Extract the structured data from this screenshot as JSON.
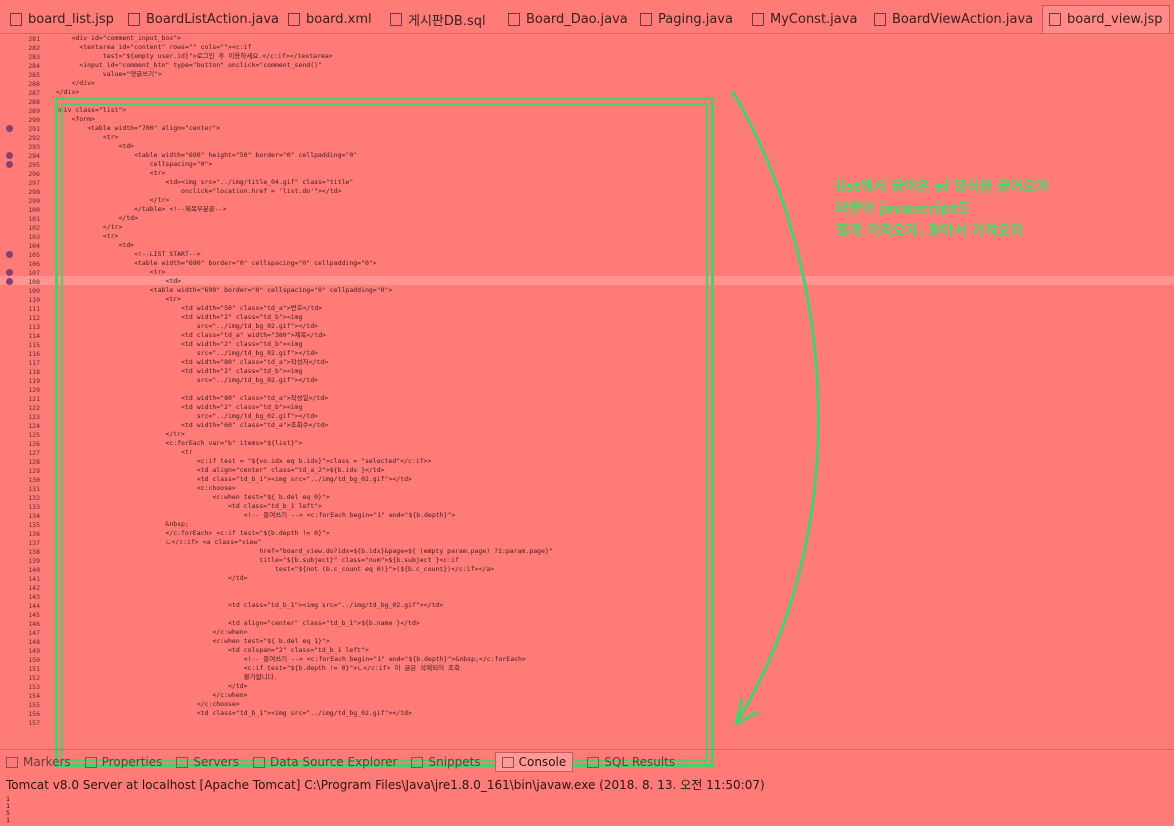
{
  "tabs": [
    {
      "label": "board_list.jsp",
      "icon": "jsp-file-icon"
    },
    {
      "label": "BoardListAction.java",
      "icon": "java-file-icon"
    },
    {
      "label": "board.xml",
      "icon": "xml-file-icon"
    },
    {
      "label": "게시판DB.sql",
      "icon": "sql-file-icon"
    },
    {
      "label": "Board_Dao.java",
      "icon": "java-file-icon"
    },
    {
      "label": "Paging.java",
      "icon": "java-file-icon"
    },
    {
      "label": "MyConst.java",
      "icon": "java-file-icon"
    },
    {
      "label": "BoardViewAction.java",
      "icon": "java-file-icon"
    },
    {
      "label": "board_view.jsp",
      "icon": "jsp-file-icon",
      "active": true
    }
  ],
  "line_numbers": [
    "281",
    "282",
    "283",
    "284",
    "285",
    "286",
    "287",
    "288",
    "289",
    "290",
    "291",
    "292",
    "293",
    "294",
    "295",
    "296",
    "297",
    "298",
    "299",
    "100",
    "101",
    "102",
    "103",
    "104",
    "105",
    "106",
    "107",
    "108",
    "109",
    "110",
    "111",
    "112",
    "113",
    "114",
    "115",
    "116",
    "117",
    "118",
    "119",
    "120",
    "121",
    "122",
    "123",
    "124",
    "125",
    "126",
    "127",
    "128",
    "129",
    "130",
    "131",
    "132",
    "133",
    "134",
    "135",
    "136",
    "137",
    "138",
    "139",
    "140",
    "141",
    "142",
    "143",
    "144",
    "145",
    "146",
    "147",
    "148",
    "149",
    "150",
    "151",
    "152",
    "153",
    "154",
    "155",
    "156",
    "157"
  ],
  "code_lines": [
    "      <div id=\"comment_input_box\">",
    "        <textarea id=\"content\" rows=\"\" cols=\"\"><c:if",
    "              test=\"${empty user.id}\">로그인 후 이용하세요.</c:if></textarea>",
    "        <input id=\"comment_btn\" type=\"button\" onclick=\"comment_send()\"",
    "              value=\"댓글쓰기\">",
    "      </div>",
    "  </div>",
    "",
    "  <div class=\"list\">",
    "      <form>",
    "          <table width=\"700\" align=\"center\">",
    "              <tr>",
    "                  <td>",
    "                      <table width=\"690\" height=\"50\" border=\"0\" cellpadding=\"0\"",
    "                          cellspacing=\"0\">",
    "                          <tr>",
    "                              <td><img src=\"../img/title_04.gif\" class=\"title\"",
    "                                  onclick=\"location.href = 'list.do'\"></td>",
    "                          </tr>",
    "                      </table> <!--제목부분끝-->",
    "                  </td>",
    "              </tr>",
    "              <tr>",
    "                  <td>",
    "                      <!--LIST START-->",
    "                      <table width=\"690\" border=\"0\" cellspacing=\"0\" cellpadding=\"0\">",
    "                          <tr>",
    "                              <td>",
    "                          <table width=\"690\" border=\"0\" cellspacing=\"0\" cellpadding=\"0\">",
    "                              <tr>",
    "                                  <td width=\"50\" class=\"td_a\">번호</td>",
    "                                  <td width=\"2\" class=\"td_b\"><img",
    "                                      src=\"../img/td_bg_02.gif\"></td>",
    "                                  <td class=\"td_a\" width=\"380\">제목</td>",
    "                                  <td width=\"2\" class=\"td_b\"><img",
    "                                      src=\"../img/td_bg_02.gif\"></td>",
    "                                  <td width=\"80\" class=\"td_a\">작성자</td>",
    "                                  <td width=\"2\" class=\"td_b\"><img",
    "                                      src=\"../img/td_bg_02.gif\"></td>",
    "",
    "                                  <td width=\"80\" class=\"td_a\">작성일</td>",
    "                                  <td width=\"2\" class=\"td_b\"><img",
    "                                      src=\"../img/td_bg_02.gif\"></td>",
    "                                  <td width=\"60\" class=\"td_a\">조회수</td>",
    "                              </tr>",
    "                              <c:forEach var=\"b\" items=\"${list}\">",
    "                                  <tr",
    "                                      <c:if test = \"${vo.idx eq b.idx}\">class = \"selected\"</c:if>>",
    "                                      <td align=\"center\" class=\"td_a_2\">${b.idx }</td>",
    "                                      <td class=\"td_b_1\"><img src=\"../img/td_bg_02.gif\"></td>",
    "                                      <c:choose>",
    "                                          <c:when test=\"${ b.del eq 0}\">",
    "                                              <td class=\"td_b_1 left\">",
    "                                                  <!-- 들여쓰기 --> <c:forEach begin=\"1\" end=\"${b.depth}\">",
    "                              &nbsp;",
    "                              </c:forEach> <c:if test=\"${b.depth != 0}\">",
    "                              ㄴ</c:if> <a class=\"view\"",
    "                                                      href=\"board_view.do?idx=${b.idx}&page=${ (empty param.page) ?1:param.page}\"",
    "                                                      title=\"${b.subject}\" class=\"num\">${b.subject }<c:if",
    "                                                          test=\"${not (b.c_count eq 0)}\">(${b.c_count})</c:if></a>",
    "                                              </td>",
    "",
    "",
    "                                              <td class=\"td_b_1\"><img src=\"../img/td_bg_02.gif\"></td>",
    "",
    "                                              <td align=\"center\" class=\"td_b_1\">${b.name }</td>",
    "                                          </c:when>",
    "                                          <c:when test=\"${ b.del eq 1}\">",
    "                                              <td colspan=\"2\" class=\"td_b_1 left\">",
    "                                                  <!-- 들여쓰기 --> <c:forEach begin=\"1\" end=\"${b.depth}\">&nbsp;</c:forEach>",
    "                                                  <c:if test=\"${b.depth != 0}\">ㄴ</c:if> 이 글은 삭제되어 조회",
    "                                                  불가합니다.",
    "                                              </td>",
    "                                          </c:when>",
    "                                      </c:choose>",
    "                                      <td class=\"td_b_1\"><img src=\"../img/td_bg_02.gif\"></td>",
    ""
  ],
  "annotation": {
    "lines": [
      "list에서 긁어온 el 양식을 긁어오자",
      "더불어 javascript도",
      "몇개 가져오자. 알아서 가져오자"
    ],
    "color": "#3fdc68"
  },
  "panel": {
    "tabs": [
      {
        "label": "Markers",
        "icon": "markers-icon"
      },
      {
        "label": "Properties",
        "icon": "properties-icon"
      },
      {
        "label": "Servers",
        "icon": "servers-icon"
      },
      {
        "label": "Data Source Explorer",
        "icon": "data-source-icon"
      },
      {
        "label": "Snippets",
        "icon": "snippets-icon"
      },
      {
        "label": "Console",
        "icon": "console-icon",
        "active": true
      },
      {
        "label": "SQL Results",
        "icon": "sql-results-icon"
      }
    ],
    "console_header": "Tomcat v8.0 Server at localhost [Apache Tomcat] C:\\Program Files\\Java\\jre1.8.0_161\\bin\\javaw.exe (2018. 8. 13. 오전 11:50:07)",
    "console_output": [
      "1",
      "1",
      "5",
      "1"
    ]
  }
}
